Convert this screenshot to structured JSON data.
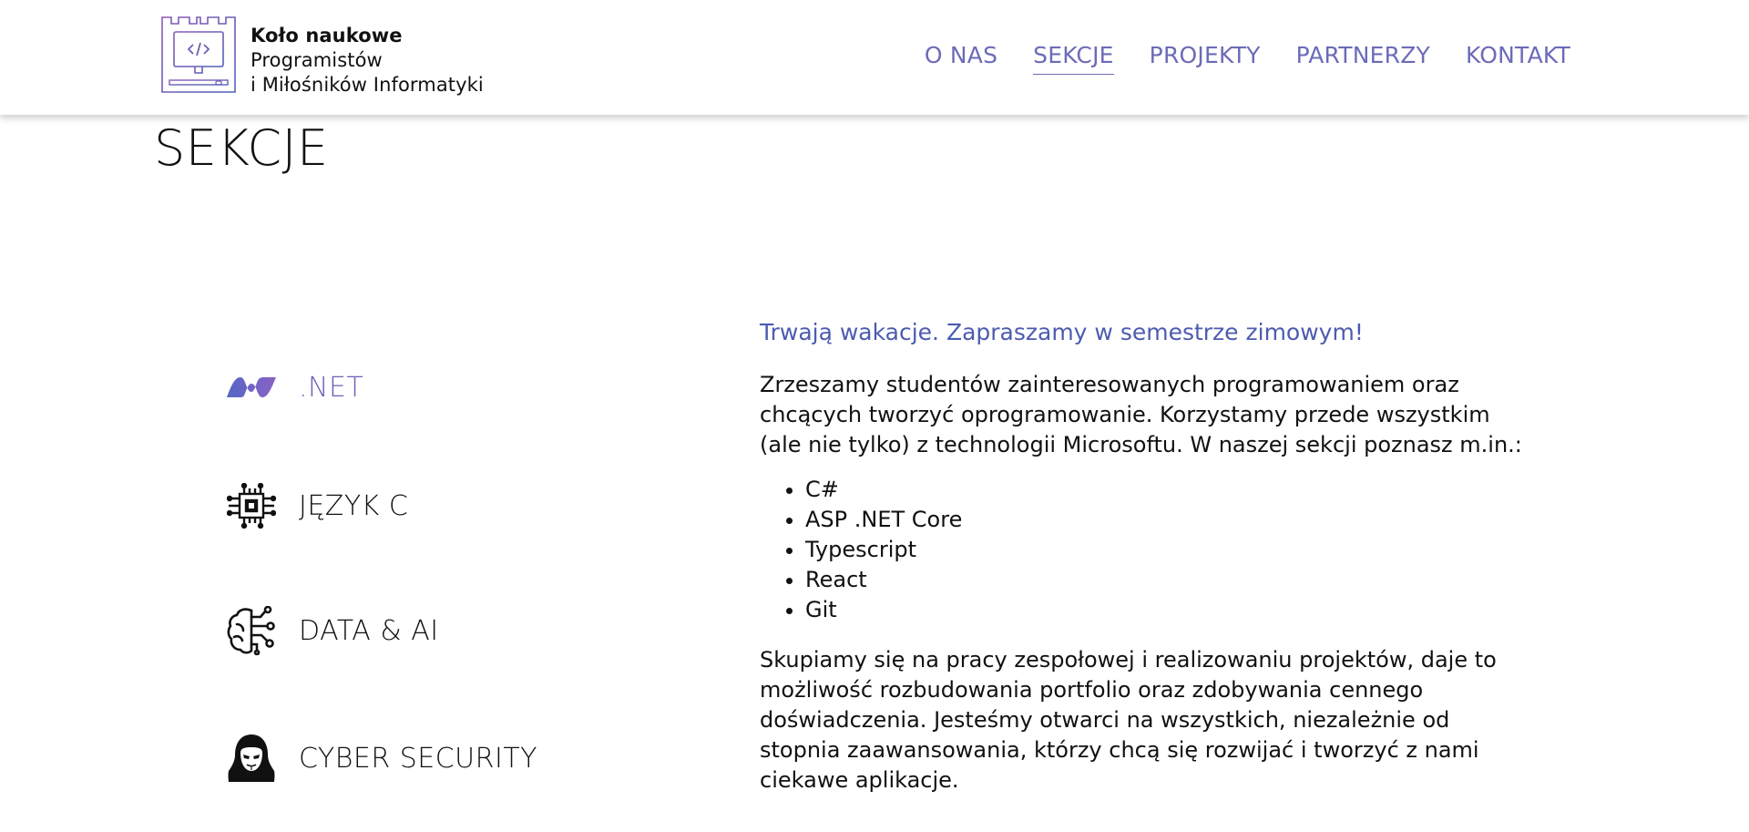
{
  "header": {
    "logo_lines": [
      "Koło naukowe",
      "Programistów",
      "i Miłośników Informatyki"
    ],
    "nav": [
      {
        "label": "O NAS",
        "active": false
      },
      {
        "label": "SEKCJE",
        "active": true
      },
      {
        "label": "PROJEKTY",
        "active": false
      },
      {
        "label": "PARTNERZY",
        "active": false
      },
      {
        "label": "KONTAKT",
        "active": false
      }
    ]
  },
  "page_title": "SEKCJE",
  "sections": [
    {
      "label": ".NET",
      "icon": "dotnet-icon",
      "active": true
    },
    {
      "label": "JĘZYK C",
      "icon": "chip-icon",
      "active": false
    },
    {
      "label": "DATA & AI",
      "icon": "brain-circuit-icon",
      "active": false
    },
    {
      "label": "CYBER SECURITY",
      "icon": "hacker-icon",
      "active": false
    }
  ],
  "content": {
    "headline": "Trwają wakacje. Zapraszamy w semestrze zimowym!",
    "intro": "Zrzeszamy studentów zainteresowanych programowaniem oraz chcących tworzyć oprogramowanie. Korzystamy przede wszystkim (ale nie tylko) z technologii Microsoftu. W naszej sekcji poznasz m.in.:",
    "technologies": [
      "C#",
      "ASP .NET Core",
      "Typescript",
      "React",
      "Git"
    ],
    "outro": "Skupiamy się na pracy zespołowej i realizowaniu projektów, daje to możliwość rozbudowania portfolio oraz zdobywania cennego doświadczenia. Jesteśmy otwarci na wszystkich, niezależnie od stopnia zaawansowania, którzy chcą się rozwijać i tworzyć z nami ciekawe aplikacje."
  },
  "colors": {
    "accent": "#6b6bb8",
    "headline": "#4c5bb0",
    "active_section": "#7161b5"
  }
}
